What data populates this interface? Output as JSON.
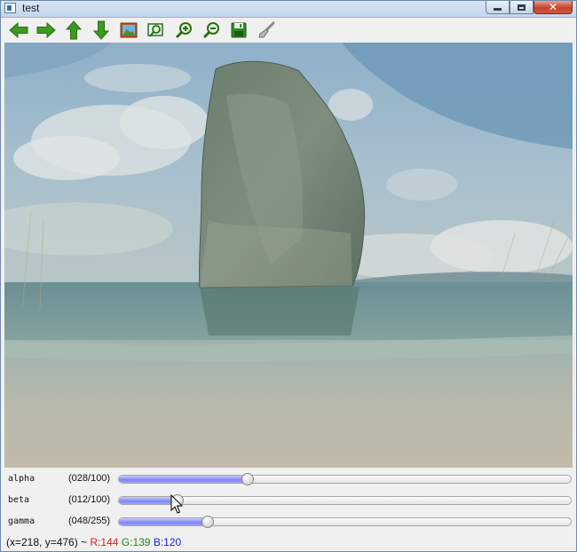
{
  "window": {
    "title": "test"
  },
  "toolbar": {
    "buttons": [
      {
        "icon": "arrow-left-icon"
      },
      {
        "icon": "arrow-right-icon"
      },
      {
        "icon": "arrow-up-icon"
      },
      {
        "icon": "arrow-down-icon"
      },
      {
        "icon": "image-icon"
      },
      {
        "icon": "zoom-fit-icon"
      },
      {
        "icon": "zoom-in-icon"
      },
      {
        "icon": "zoom-out-icon"
      },
      {
        "icon": "save-icon"
      },
      {
        "icon": "properties-brush-icon"
      }
    ]
  },
  "trackbars": [
    {
      "name": "alpha",
      "value_text": "(028/100)",
      "value": 28,
      "max": 100
    },
    {
      "name": "beta",
      "value_text": "(012/100)",
      "value": 12,
      "max": 100
    },
    {
      "name": "gamma",
      "value_text": "(048/255)",
      "value": 48,
      "max": 255
    }
  ],
  "status": {
    "coords": "(x=218, y=476) ~",
    "r": "R:144",
    "g": "G:139",
    "b": "B:120"
  },
  "colors": {
    "green_icon": "#3c9a1e",
    "fill_accent": "#8088f0",
    "r": "#e01b1b",
    "g": "#1a8a1a",
    "b": "#1b1be0"
  }
}
